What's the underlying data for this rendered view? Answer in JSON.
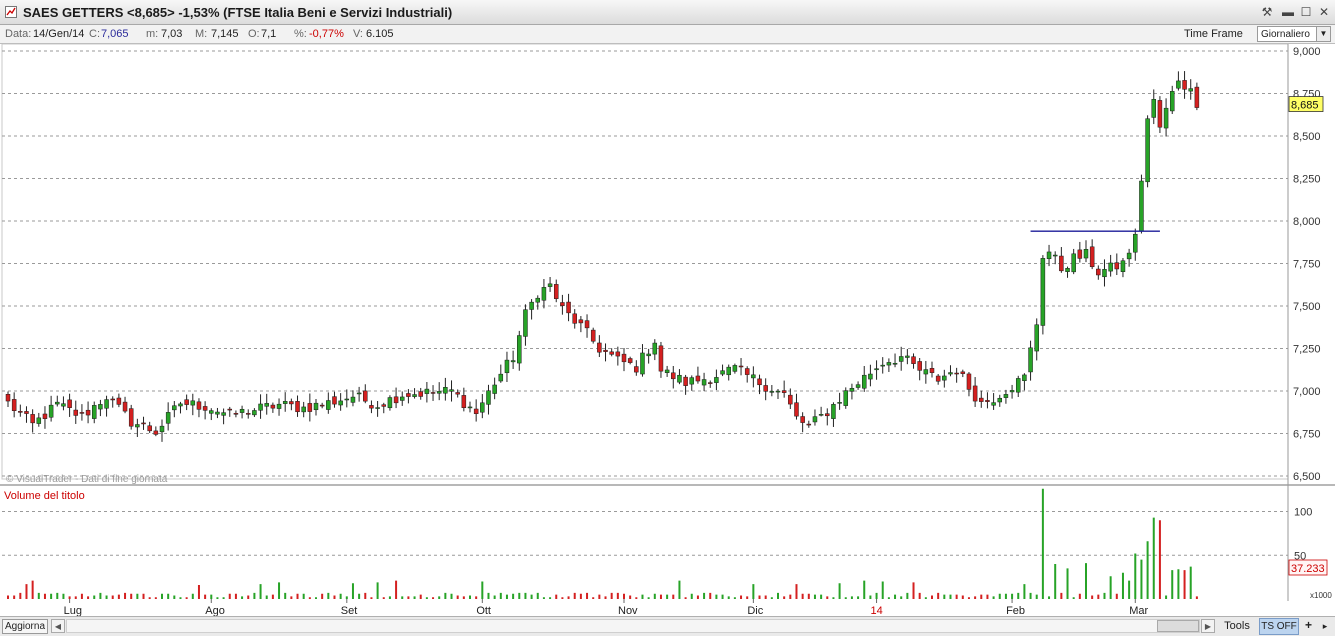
{
  "window": {
    "title": "SAES GETTERS <8,685> -1,53%  (FTSE Italia Beni e Servizi Industriali)",
    "buttons": {
      "tools": "⚒",
      "minimize": "▬",
      "maximize": "☐",
      "close": "✕"
    }
  },
  "infobar": {
    "date_label": "Data:",
    "date_value": "14/Gen/14",
    "close_label": "C:",
    "close_value": "7,065",
    "min_label": "m:",
    "min_value": "7,03",
    "max_label": "M:",
    "max_value": "7,145",
    "open_label": "O:",
    "open_value": "7,1",
    "pct_label": "%:",
    "pct_value": "-0,77%",
    "vol_label": "V:",
    "vol_value": "6.105",
    "timeframe_label": "Time Frame",
    "timeframe_value": "Giornaliero"
  },
  "chart": {
    "watermark": "© VisualTrader - Dati di fine giornata",
    "volume_title": "Volume del titolo",
    "last_price_label": "8,685",
    "last_volume_label": "37.233",
    "volume_multiplier": "x1000",
    "colors": {
      "up": "#27a327",
      "down": "#d42020",
      "resistance": "#1c1c99",
      "grid": "#9a9a9a",
      "highlight": "#ffff66"
    }
  },
  "chart_data": {
    "type": "candlestick",
    "price_axis": {
      "ticks": [
        "6,500",
        "6,750",
        "7,000",
        "7,250",
        "7,500",
        "7,750",
        "8,000",
        "8,250",
        "8,500",
        "8,750",
        "9,000"
      ],
      "range": [
        6.5,
        9.0
      ]
    },
    "volume_axis": {
      "ticks": [
        "50",
        "100"
      ],
      "range": [
        0,
        100
      ],
      "unit": "x1000"
    },
    "months": [
      {
        "label": "Lug",
        "day": 10,
        "highlight": false
      },
      {
        "label": "Ago",
        "day": 33,
        "highlight": false
      },
      {
        "label": "Set",
        "day": 55,
        "highlight": false
      },
      {
        "label": "Ott",
        "day": 77,
        "highlight": false
      },
      {
        "label": "Nov",
        "day": 100,
        "highlight": false
      },
      {
        "label": "Dic",
        "day": 121,
        "highlight": false
      },
      {
        "label": "14",
        "day": 141,
        "highlight": true
      },
      {
        "label": "Feb",
        "day": 163,
        "highlight": false
      },
      {
        "label": "Mar",
        "day": 183,
        "highlight": false
      }
    ],
    "resistance_line": {
      "price": 7.94,
      "from_day": 166,
      "to_day": 187
    },
    "anchors": [
      [
        0,
        6.93
      ],
      [
        4,
        6.8
      ],
      [
        8,
        6.92
      ],
      [
        12,
        6.85
      ],
      [
        16,
        6.97
      ],
      [
        20,
        6.82
      ],
      [
        24,
        6.76
      ],
      [
        28,
        6.93
      ],
      [
        32,
        6.91
      ],
      [
        36,
        6.86
      ],
      [
        40,
        6.89
      ],
      [
        44,
        6.92
      ],
      [
        48,
        6.9
      ],
      [
        52,
        6.93
      ],
      [
        56,
        6.97
      ],
      [
        60,
        6.92
      ],
      [
        64,
        6.98
      ],
      [
        68,
        6.99
      ],
      [
        72,
        7.0
      ],
      [
        76,
        6.87
      ],
      [
        79,
        7.05
      ],
      [
        82,
        7.2
      ],
      [
        84,
        7.45
      ],
      [
        86,
        7.58
      ],
      [
        88,
        7.62
      ],
      [
        90,
        7.48
      ],
      [
        93,
        7.38
      ],
      [
        96,
        7.25
      ],
      [
        99,
        7.18
      ],
      [
        102,
        7.14
      ],
      [
        105,
        7.3
      ],
      [
        106,
        7.12
      ],
      [
        110,
        7.05
      ],
      [
        114,
        7.08
      ],
      [
        118,
        7.13
      ],
      [
        122,
        7.05
      ],
      [
        126,
        6.98
      ],
      [
        128,
        6.84
      ],
      [
        130,
        6.79
      ],
      [
        133,
        6.88
      ],
      [
        136,
        6.99
      ],
      [
        139,
        7.08
      ],
      [
        142,
        7.17
      ],
      [
        145,
        7.2
      ],
      [
        148,
        7.12
      ],
      [
        151,
        7.07
      ],
      [
        154,
        7.13
      ],
      [
        156,
        7.02
      ],
      [
        158,
        6.93
      ],
      [
        160,
        6.96
      ],
      [
        163,
        7.03
      ],
      [
        165,
        7.08
      ],
      [
        167,
        7.4
      ],
      [
        168,
        7.8
      ],
      [
        169,
        7.82
      ],
      [
        171,
        7.72
      ],
      [
        173,
        7.78
      ],
      [
        175,
        7.8
      ],
      [
        177,
        7.7
      ],
      [
        179,
        7.72
      ],
      [
        181,
        7.75
      ],
      [
        183,
        7.9
      ],
      [
        185,
        8.6
      ],
      [
        186,
        8.7
      ],
      [
        187,
        8.55
      ],
      [
        189,
        8.75
      ],
      [
        190,
        8.84
      ],
      [
        192,
        8.76
      ],
      [
        193,
        8.7
      ]
    ],
    "big_volume_days": [
      [
        168,
        126
      ],
      [
        170,
        40
      ],
      [
        172,
        35
      ],
      [
        175,
        41
      ],
      [
        179,
        26
      ],
      [
        181,
        30
      ],
      [
        183,
        52
      ],
      [
        184,
        45
      ],
      [
        185,
        66
      ],
      [
        186,
        93
      ],
      [
        187,
        90
      ],
      [
        189,
        33
      ],
      [
        190,
        34
      ],
      [
        191,
        33
      ],
      [
        192,
        37
      ]
    ]
  }
}
